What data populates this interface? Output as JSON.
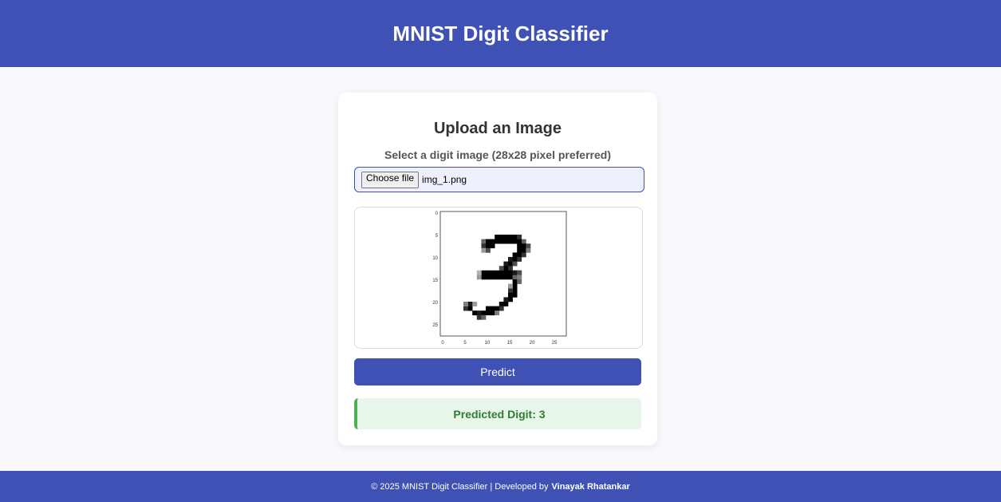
{
  "header": {
    "title": "MNIST Digit Classifier"
  },
  "card": {
    "heading": "Upload an Image",
    "instruction": "Select a digit image (28x28 pixel preferred)",
    "file_button_label": "Choose file",
    "file_name": "img_1.png",
    "preview": {
      "y_ticks": [
        "0",
        "5",
        "10",
        "15",
        "20",
        "25"
      ],
      "x_ticks": [
        "0",
        "5",
        "10",
        "15",
        "20",
        "25"
      ]
    },
    "predict_label": "Predict",
    "result_text": "Predicted Digit: 3"
  },
  "footer": {
    "text": "© 2025 MNIST Digit Classifier | Developed by",
    "author": "Vinayak Rhatankar"
  },
  "colors": {
    "primary": "#3f51b5",
    "success_text": "#2e7d32",
    "success_bg": "#e8f5e9",
    "success_border": "#4caf50"
  }
}
